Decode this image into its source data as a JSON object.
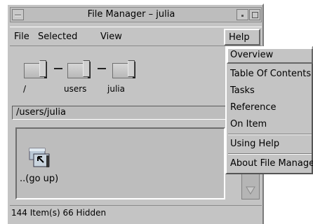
{
  "window": {
    "title": "File Manager – julia"
  },
  "menubar": {
    "file": "File",
    "selected": "Selected",
    "view": "View",
    "help": "Help"
  },
  "path_icons": [
    {
      "label": "/"
    },
    {
      "label": "users"
    },
    {
      "label": "julia"
    }
  ],
  "path_field": {
    "value": "/users/julia"
  },
  "files": [
    {
      "name": "..(go up)",
      "icon": "folder-up-icon"
    }
  ],
  "status": {
    "text": "144 Item(s) 66 Hidden"
  },
  "help_menu": {
    "items": [
      {
        "label": "Overview",
        "active": true
      },
      {
        "label": "Table Of Contents"
      },
      {
        "label": "Tasks"
      },
      {
        "label": "Reference"
      },
      {
        "label": "On Item"
      },
      {
        "label": "Using Help"
      },
      {
        "label": "About File Manager"
      }
    ]
  }
}
